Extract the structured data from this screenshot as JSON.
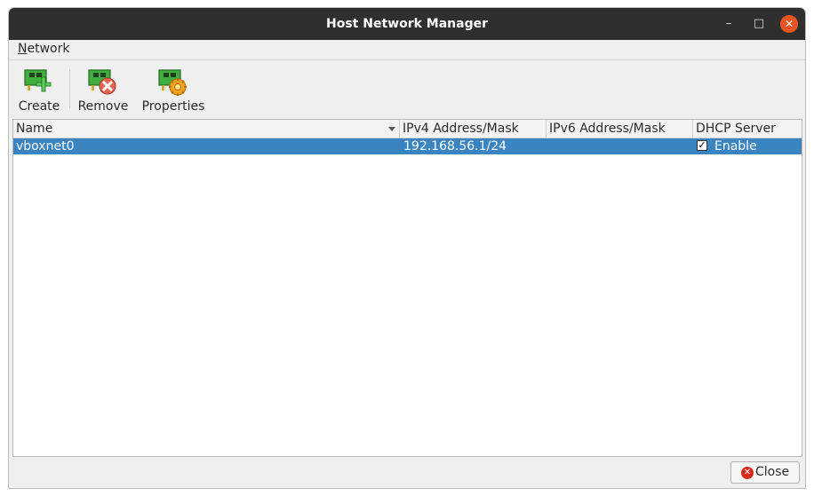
{
  "window": {
    "title": "Host Network Manager",
    "controls": {
      "minimize": "–",
      "maximize": "□",
      "close": "✕"
    }
  },
  "menu": {
    "network_mnemonic": "N",
    "network_rest": "etwork"
  },
  "toolbar": {
    "create_label": "Create",
    "remove_label": "Remove",
    "properties_label": "Properties"
  },
  "table": {
    "columns": [
      "Name",
      "IPv4 Address/Mask",
      "IPv6 Address/Mask",
      "DHCP Server"
    ],
    "rows": [
      {
        "name": "vboxnet0",
        "ipv4": "192.168.56.1/24",
        "ipv6": "",
        "dhcp_checked": true,
        "dhcp_label": "Enable",
        "check_glyph": "✓"
      }
    ]
  },
  "footer": {
    "close_label": "Close",
    "close_glyph": "✕"
  },
  "colors": {
    "selection": "#3a84c2",
    "titlebar": "#2f2f2f",
    "close_accent": "#e9541f"
  }
}
